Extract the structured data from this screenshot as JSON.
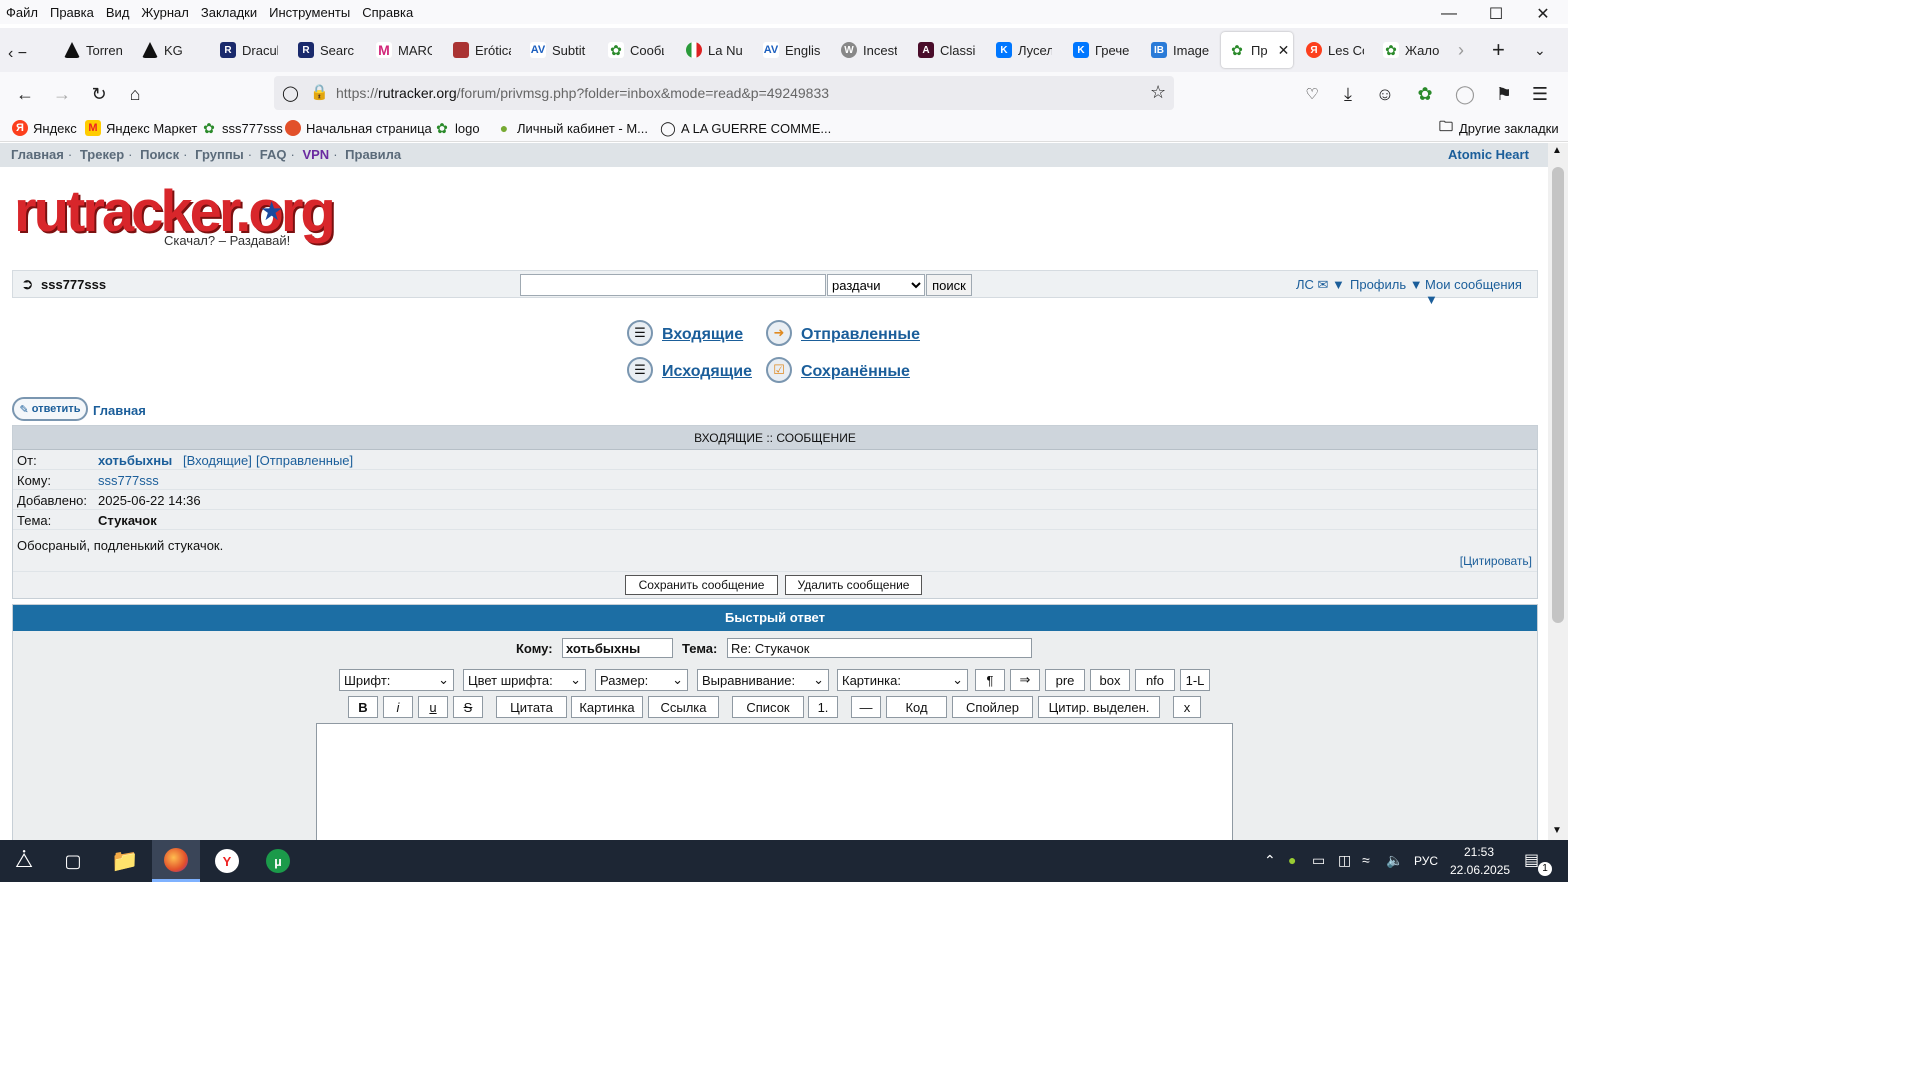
{
  "menubar": {
    "items": [
      "Файл",
      "Правка",
      "Вид",
      "Журнал",
      "Закладки",
      "Инструменты",
      "Справка"
    ]
  },
  "tabs": [
    {
      "label": "Torren",
      "icon": "warning-icon"
    },
    {
      "label": "KG",
      "icon": "warning-icon"
    },
    {
      "label": "Dracul",
      "icon": "app-icon"
    },
    {
      "label": "Search",
      "icon": "app-icon"
    },
    {
      "label": "MARG",
      "icon": "m-icon"
    },
    {
      "label": "Erótica",
      "icon": "site-icon"
    },
    {
      "label": "Subtit",
      "icon": "avsubs-icon"
    },
    {
      "label": "Сообщ",
      "icon": "rutracker-icon"
    },
    {
      "label": "La Nu",
      "icon": "flag-italy-icon"
    },
    {
      "label": "Englis",
      "icon": "avsubs-icon"
    },
    {
      "label": "Incest",
      "icon": "wordpress-icon"
    },
    {
      "label": "Classic",
      "icon": "ai-icon"
    },
    {
      "label": "Лусел",
      "icon": "vk-icon"
    },
    {
      "label": "Грече",
      "icon": "vk-icon"
    },
    {
      "label": "Image",
      "icon": "ib-icon"
    },
    {
      "label": "Пр",
      "icon": "rutracker-icon"
    },
    {
      "label": "Les Co",
      "icon": "yandex-icon"
    },
    {
      "label": "Жало",
      "icon": "rutracker-icon"
    }
  ],
  "url": {
    "prefix": "https://",
    "domain": "rutracker.org",
    "path": "/forum/privmsg.php?folder=inbox&mode=read&p=49249833"
  },
  "bookmarks": [
    "Яндекс",
    "Яндекс Маркет",
    "sss777sss",
    "Начальная страница",
    "logo",
    "Личный кабинет - М...",
    "A LA GUERRE COMME..."
  ],
  "other_bookmarks": "Другие закладки",
  "site": {
    "nav": [
      "Главная",
      "Трекер",
      "Поиск",
      "Группы",
      "FAQ",
      "VPN",
      "Правила"
    ],
    "nav_right": "Atomic Heart",
    "logo_text": "rutracker.org",
    "logo_slogan": "Скачал? – Раздавай!",
    "username": "sss777sss",
    "search_scope": "раздачи",
    "search_button": "поиск",
    "user_links": [
      "ЛС ✉",
      "Профиль",
      "Мои сообщения"
    ],
    "folders": [
      "Входящие",
      "Отправленные",
      "Исходящие",
      "Сохранённые"
    ],
    "reply_button": "ответить",
    "crumb": "Главная"
  },
  "message": {
    "header": "ВХОДЯЩИЕ :: СООБЩЕНИЕ",
    "from_label": "От:",
    "from": "хотьбыхны",
    "from_inbox": "[Входящие]",
    "from_sent": "[Отправленные]",
    "to_label": "Кому:",
    "to": "sss777sss",
    "added_label": "Добавлено:",
    "added": "2025-06-22 14:36",
    "subject_label": "Тема:",
    "subject": "Стукачок",
    "body": "Обосраный, подленький стукачок.",
    "quote": "[Цитировать]",
    "save_button": "Сохранить сообщение",
    "delete_button": "Удалить сообщение"
  },
  "quick_reply": {
    "title": "Быстрый ответ",
    "to_label": "Кому:",
    "to_value": "хотьбыхны",
    "subject_label": "Тема:",
    "subject_value": "Re: Стукачок",
    "selects": [
      "Шрифт:",
      "Цвет шрифта:",
      "Размер:",
      "Выравнивание:",
      "Картинка:"
    ],
    "row1_buttons": [
      "¶",
      "⇒",
      "pre",
      "box",
      "nfo",
      "1-L"
    ],
    "row2_buttons": [
      "B",
      "i",
      "u",
      "S",
      "Цитата",
      "Картинка",
      "Ссылка",
      "Список",
      "1.",
      "—",
      "Код",
      "Спойлер",
      "Цитир. выделен.",
      "x"
    ]
  },
  "taskbar": {
    "lang": "РУС",
    "time": "21:53",
    "date": "22.06.2025",
    "notif": "1"
  }
}
